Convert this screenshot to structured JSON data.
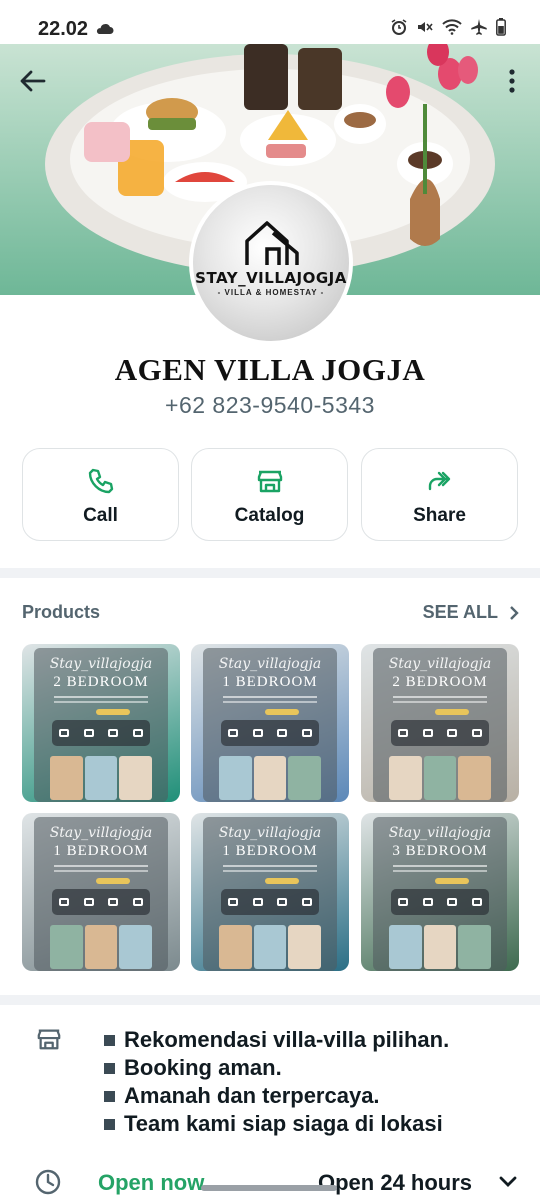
{
  "status_bar": {
    "time": "22.02",
    "icons": [
      "cloud-icon",
      "alarm-icon",
      "mute-icon",
      "wifi-icon",
      "airplane-icon",
      "battery-icon"
    ]
  },
  "header": {
    "back_icon": "arrow-left-icon",
    "menu_icon": "more-vert-icon"
  },
  "profile": {
    "logo_name": "STAY_VILLAJOGJA",
    "logo_tagline": "- VILLA & HOMESTAY -",
    "name": "AGEN VILLA JOGJA",
    "phone": "+62 823-9540-5343"
  },
  "actions": [
    {
      "label": "Call",
      "icon": "phone-icon"
    },
    {
      "label": "Catalog",
      "icon": "store-icon"
    },
    {
      "label": "Share",
      "icon": "forward-icon"
    }
  ],
  "products": {
    "title": "Products",
    "see_all": "SEE ALL",
    "items": [
      {
        "script": "Stay_villajogja",
        "room": "2 BEDROOM",
        "color": "#1f8f78"
      },
      {
        "script": "Stay_villajogja",
        "room": "1 BEDROOM",
        "color": "#5c88b8"
      },
      {
        "script": "Stay_villajogja",
        "room": "2 BEDROOM",
        "color": "#b8b0a4"
      },
      {
        "script": "Stay_villajogja",
        "room": "1 BEDROOM",
        "color": "#7c8a8e"
      },
      {
        "script": "Stay_villajogja",
        "room": "1 BEDROOM",
        "color": "#2b6f86"
      },
      {
        "script": "Stay_villajogja",
        "room": "3 BEDROOM",
        "color": "#3e6a4f"
      }
    ]
  },
  "description": {
    "icon": "store-icon",
    "lines": [
      "Rekomendasi villa-villa pilihan.",
      "Booking aman.",
      "Amanah dan terpercaya.",
      "Team kami siap siaga di lokasi"
    ]
  },
  "hours": {
    "icon": "clock-icon",
    "status": "Open now",
    "schedule": "Open 24 hours",
    "expand_icon": "chevron-down-icon"
  },
  "colors": {
    "accent": "#25a366",
    "secondary_text": "#54656f",
    "divider": "#f0f2f5"
  }
}
